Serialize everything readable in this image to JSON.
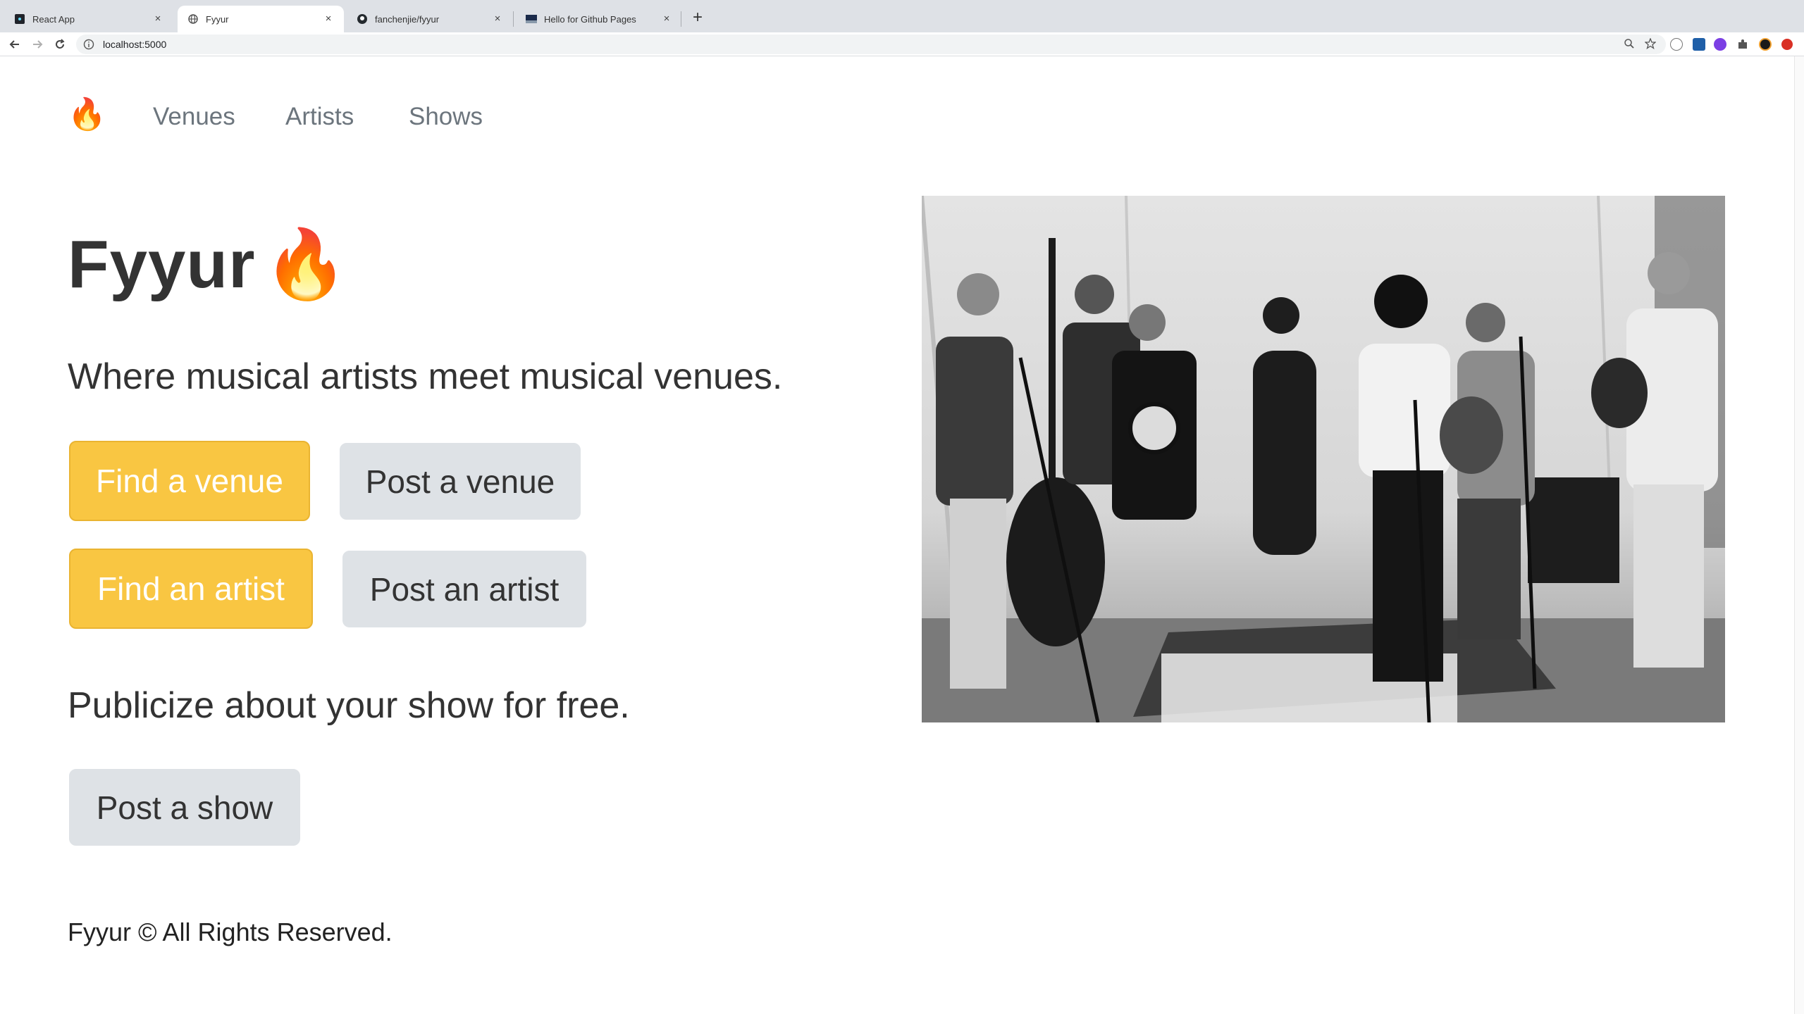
{
  "browser": {
    "tabs": [
      {
        "title": "React App",
        "icon": "react-app-icon"
      },
      {
        "title": "Fyyur",
        "icon": "globe-icon"
      },
      {
        "title": "fanchenjie/fyyur",
        "icon": "github-icon"
      },
      {
        "title": "Hello for Github Pages",
        "icon": "page-icon"
      }
    ],
    "new_tab": "+",
    "url": "localhost:5000",
    "close": "×"
  },
  "nav": {
    "logo": "🔥",
    "links": [
      "Venues",
      "Artists",
      "Shows"
    ]
  },
  "hero": {
    "title": "Fyyur",
    "title_icon": "🔥",
    "lead": "Where musical artists meet musical venues.",
    "buttons": {
      "find_venue": "Find a venue",
      "post_venue": "Post a venue",
      "find_artist": "Find an artist",
      "post_artist": "Post an artist"
    },
    "publicize": "Publicize about your show for free.",
    "post_show": "Post a show"
  },
  "footer": "Fyyur © All Rights Reserved.",
  "colors": {
    "warning": "#f9c642",
    "light": "#dee2e6",
    "nav_link": "#6c757d"
  },
  "image": {
    "icon": "band-photo"
  }
}
